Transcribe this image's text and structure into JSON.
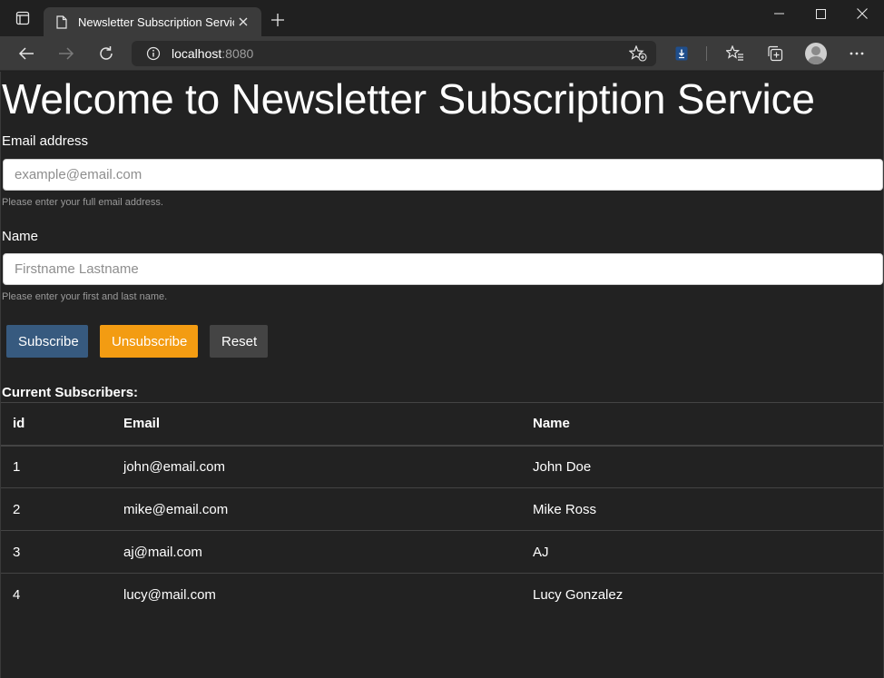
{
  "browser": {
    "tab_title": "Newsletter Subscription Service",
    "url_host": "localhost",
    "url_port": ":8080"
  },
  "page": {
    "heading": "Welcome to Newsletter Subscription Service",
    "email": {
      "label": "Email address",
      "placeholder": "example@email.com",
      "value": "",
      "help": "Please enter your full email address."
    },
    "name": {
      "label": "Name",
      "placeholder": "Firstname Lastname",
      "value": "",
      "help": "Please enter your first and last name."
    },
    "buttons": {
      "subscribe": "Subscribe",
      "unsubscribe": "Unsubscribe",
      "reset": "Reset"
    },
    "colors": {
      "subscribe": "#375a7f",
      "unsubscribe": "#f39c12",
      "reset": "#444444"
    },
    "subscribers_heading": "Current Subscribers:",
    "table": {
      "headers": [
        "id",
        "Email",
        "Name"
      ],
      "rows": [
        [
          "1",
          "john@email.com",
          "John Doe"
        ],
        [
          "2",
          "mike@email.com",
          "Mike Ross"
        ],
        [
          "3",
          "aj@mail.com",
          "AJ"
        ],
        [
          "4",
          "lucy@mail.com",
          "Lucy Gonzalez"
        ]
      ]
    }
  }
}
